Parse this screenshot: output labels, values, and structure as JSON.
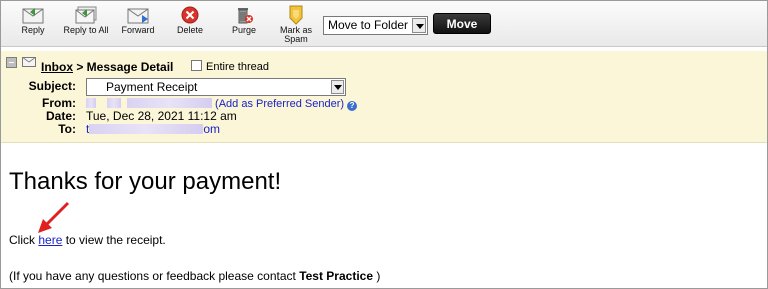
{
  "toolbar": {
    "buttons": [
      {
        "label": "Reply",
        "icon": "reply-icon"
      },
      {
        "label": "Reply to All",
        "icon": "reply-all-icon"
      },
      {
        "label": "Forward",
        "icon": "forward-icon"
      },
      {
        "label": "Delete",
        "icon": "delete-icon"
      },
      {
        "label": "Purge",
        "icon": "purge-icon"
      },
      {
        "label": "Mark as",
        "label2": "Spam",
        "icon": "mark-spam-icon"
      }
    ],
    "folder_select": "Move to Folder",
    "move_label": "Move"
  },
  "header": {
    "breadcrumb_inbox": "Inbox",
    "breadcrumb_rest": " > Message Detail",
    "entire_thread": "Entire thread",
    "subject_label": "Subject:",
    "subject_value": "Payment Receipt",
    "from_label": "From:",
    "preferred_link": "(Add as Preferred Sender)",
    "date_label": "Date:",
    "date_value": "Tue, Dec 28, 2021 11:12 am",
    "to_label": "To:",
    "to_prefix": "t",
    "to_suffix": "om"
  },
  "body": {
    "title": "Thanks for your payment!",
    "click_before": "Click ",
    "here": "here",
    "click_after": " to view the receipt.",
    "contact_before": "(If you have any questions or feedback please contact ",
    "contact_name": "Test Practice",
    "contact_after": " )"
  },
  "colors": {
    "header_bg": "#fbf6d8",
    "link": "#1a22c8",
    "annotation_arrow": "#e02020",
    "delete_red": "#d9342b"
  }
}
